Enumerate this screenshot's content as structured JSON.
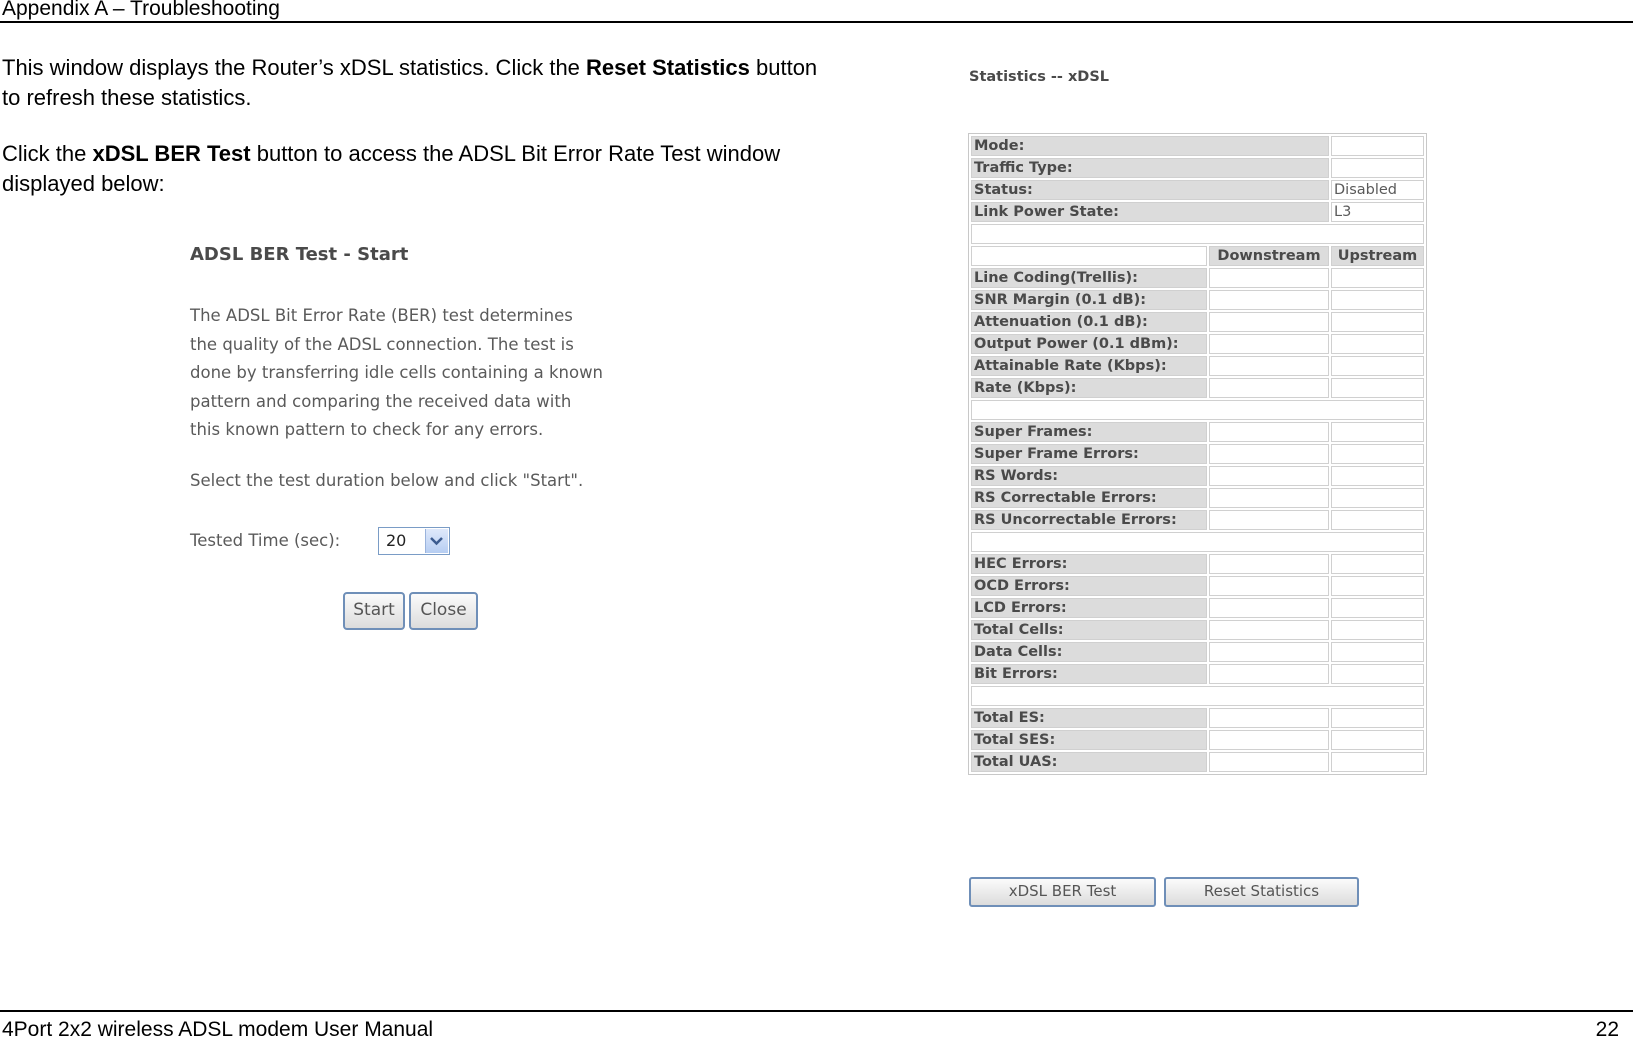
{
  "header": {
    "title": "Appendix A – Troubleshooting"
  },
  "intro": {
    "p1_before": "This window displays the Router’s xDSL statistics. Click the ",
    "p1_bold": "Reset Statistics",
    "p1_after": " button to refresh these statistics.",
    "p2_before": "Click the ",
    "p2_bold": "xDSL BER Test",
    "p2_after": " button to access the ADSL Bit Error Rate Test window displayed below:"
  },
  "ber_dialog": {
    "title": "ADSL BER Test - Start",
    "description": [
      "The ADSL Bit Error Rate (BER) test determines",
      "the quality of the ADSL connection. The test is",
      "done by transferring idle cells containing a known",
      "pattern and comparing the received data with",
      "this known pattern to check for any errors."
    ],
    "instruction": "Select the test duration below and click \"Start\".",
    "tested_time_label": "Tested Time (sec):",
    "tested_time_value": "20",
    "start_label": "Start",
    "close_label": "Close"
  },
  "stats": {
    "title": "Statistics -- xDSL",
    "mode_label": "Mode:",
    "mode_value": "",
    "traffic_type_label": "Traffic Type:",
    "traffic_type_value": "",
    "status_label": "Status:",
    "status_value": "Disabled",
    "link_power_label": "Link Power State:",
    "link_power_value": "L3",
    "col_downstream": "Downstream",
    "col_upstream": "Upstream",
    "group1": [
      "Line Coding(Trellis):",
      "SNR Margin (0.1 dB):",
      "Attenuation (0.1 dB):",
      "Output Power (0.1 dBm):",
      "Attainable Rate (Kbps):",
      "Rate (Kbps):"
    ],
    "group2": [
      "Super Frames:",
      "Super Frame Errors:",
      "RS Words:",
      "RS Correctable Errors:",
      "RS Uncorrectable Errors:"
    ],
    "group3": [
      "HEC Errors:",
      "OCD Errors:",
      "LCD Errors:",
      "Total Cells:",
      "Data Cells:",
      "Bit Errors:"
    ],
    "group4": [
      "Total ES:",
      "Total SES:",
      "Total UAS:"
    ],
    "ber_button": "xDSL BER Test",
    "reset_button": "Reset Statistics"
  },
  "footer": {
    "manual": "4Port 2x2 wireless ADSL modem User Manual",
    "page": "22"
  }
}
